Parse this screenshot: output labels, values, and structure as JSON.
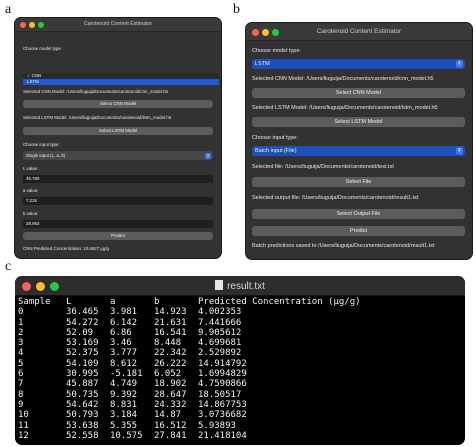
{
  "panels": {
    "a": "a",
    "b": "b",
    "c": "c"
  },
  "window_a": {
    "title": "Carotenoid Content Estimator",
    "model_type_label": "Choose model type:",
    "model_options": [
      "CNN",
      "LSTM"
    ],
    "model_selected": "LSTM",
    "cnn_model_text": "Selected CNN Model: /Users/liuguija/Documents/carotenoid/cnn_model.h5",
    "select_cnn_button": "Select CNN Model",
    "lstm_model_text": "Selected LSTM Model: /Users/liuguija/Documents/carotenoid/lstm_model.h5",
    "select_lstm_button": "Select LSTM Model",
    "input_type_label": "Choose input type:",
    "input_type_selected": "Single input (L, a, b)",
    "l_label": "L value:",
    "l_value": "46.789",
    "a_label": "a value:",
    "a_value": "7.226",
    "b_label": "b value:",
    "b_value": "28.963",
    "predict_button": "Predict",
    "result_text": "CNN Predicted Concentration: 10.6627 µg/g"
  },
  "window_b": {
    "title": "Carotenoid Content Estimator",
    "model_type_label": "Choose model type:",
    "model_selected": "LSTM",
    "cnn_model_text": "Selected CNN Model: /Users/liuguija/Documents/carotenoid/cnn_model.h5",
    "select_cnn_button": "Select CNN Model",
    "lstm_model_text": "Selected LSTM Model: /Users/liuguija/Documents/carotenoid/lstm_model.h5",
    "select_lstm_button": "Select LSTM Model",
    "input_type_label": "Choose input type:",
    "input_type_selected": "Batch input (File)",
    "selected_file_text": "Selected file: /Users/liuguija/Documents/carotenoid/test.txt",
    "select_file_button": "Select File",
    "selected_output_text": "Selected output file: /Users/liuguija/Documents/carotenoid/result1.txt",
    "select_output_button": "Select Output File",
    "predict_button": "Predict",
    "status_text": "Batch predictions saved to /Users/liuguija/Documents/carotenoid/result1.txt"
  },
  "terminal": {
    "title": "result.txt",
    "columns": [
      "Sample",
      "L",
      "a",
      "b",
      "Predicted Concentration (µg/g)"
    ],
    "rows": [
      [
        "0",
        "36.465",
        "3.981",
        "14.923",
        "4.002353"
      ],
      [
        "1",
        "54.272",
        "6.142",
        "21.631",
        "7.441666"
      ],
      [
        "2",
        "52.09",
        "6.86",
        "16.541",
        "9.905612"
      ],
      [
        "3",
        "53.169",
        "3.46",
        "8.448",
        "4.699681"
      ],
      [
        "4",
        "52.375",
        "3.777",
        "22.342",
        "2.529892"
      ],
      [
        "5",
        "54.109",
        "8.612",
        "26.222",
        "14.914792"
      ],
      [
        "6",
        "30.995",
        "-5.181",
        "6.052",
        "1.6994829"
      ],
      [
        "7",
        "45.887",
        "4.749",
        "18.902",
        "4.7590866"
      ],
      [
        "8",
        "50.735",
        "9.392",
        "28.647",
        "18.50517"
      ],
      [
        "9",
        "54.642",
        "8.831",
        "24.332",
        "14.867753"
      ],
      [
        "10",
        "50.793",
        "3.184",
        "14.87",
        "3.0736682"
      ],
      [
        "11",
        "53.638",
        "5.355",
        "16.512",
        "5.93893"
      ],
      [
        "12",
        "52.558",
        "10.575",
        "27.841",
        "21.418104"
      ]
    ]
  }
}
